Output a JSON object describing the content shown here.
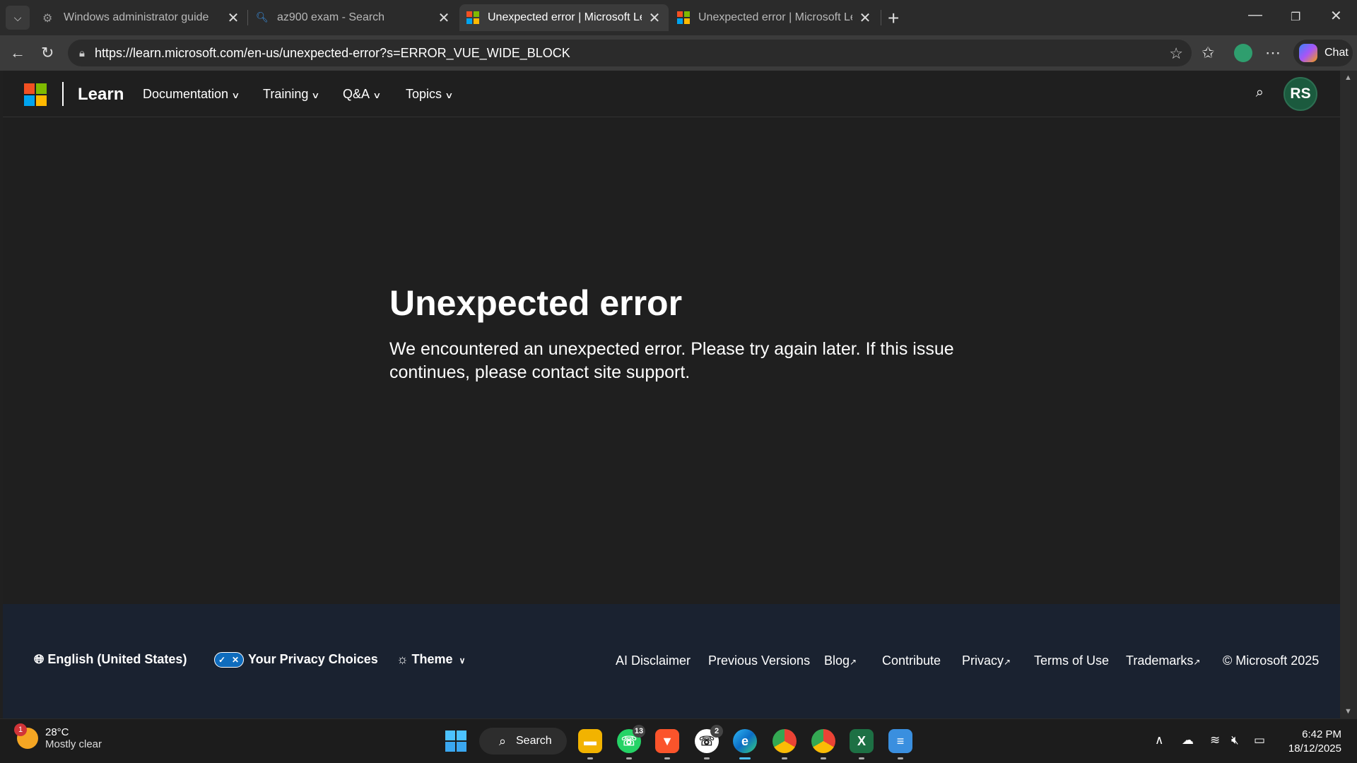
{
  "browser": {
    "tabs": [
      {
        "title": "Windows administrator guide",
        "icon": "copilot-search-icon",
        "active": false
      },
      {
        "title": "az900 exam - Search",
        "icon": "search-icon",
        "active": false
      },
      {
        "title": "Unexpected error | Microsoft Learn",
        "icon": "microsoft-logo-icon",
        "active": true
      },
      {
        "title": "Unexpected error | Microsoft Learn",
        "icon": "microsoft-logo-icon",
        "active": false
      }
    ],
    "url": "https://learn.microsoft.com/en-us/unexpected-error?s=ERROR_VUE_WIDE_BLOCK",
    "chat_label": "Chat"
  },
  "header": {
    "brand": "Learn",
    "nav": [
      {
        "label": "Documentation"
      },
      {
        "label": "Training"
      },
      {
        "label": "Q&A"
      },
      {
        "label": "Topics"
      }
    ],
    "avatar_initials": "RS"
  },
  "main": {
    "title": "Unexpected error",
    "message": "We encountered an unexpected error. Please try again later. If this issue continues, please contact site support."
  },
  "footer": {
    "language": "English (United States)",
    "privacy_choices": "Your Privacy Choices",
    "theme": "Theme",
    "links": [
      {
        "label": "AI Disclaimer",
        "external": false
      },
      {
        "label": "Previous Versions",
        "external": false
      },
      {
        "label": "Blog",
        "external": true
      },
      {
        "label": "Contribute",
        "external": false
      },
      {
        "label": "Privacy",
        "external": true
      },
      {
        "label": "Terms of Use",
        "external": false
      },
      {
        "label": "Trademarks",
        "external": true
      }
    ],
    "copyright": "© Microsoft 2025"
  },
  "taskbar": {
    "weather_badge": "1",
    "temperature": "28°C",
    "condition": "Mostly clear",
    "search_label": "Search",
    "whatsapp_count": "13",
    "whatsapp2_count": "2",
    "time": "6:42 PM",
    "date": "18/12/2025"
  },
  "colors": {
    "page_bg": "#1f1f1f",
    "footer_bg": "#1a2230",
    "accent": "#0f6cbd",
    "avatar": "#1b5a3e"
  }
}
